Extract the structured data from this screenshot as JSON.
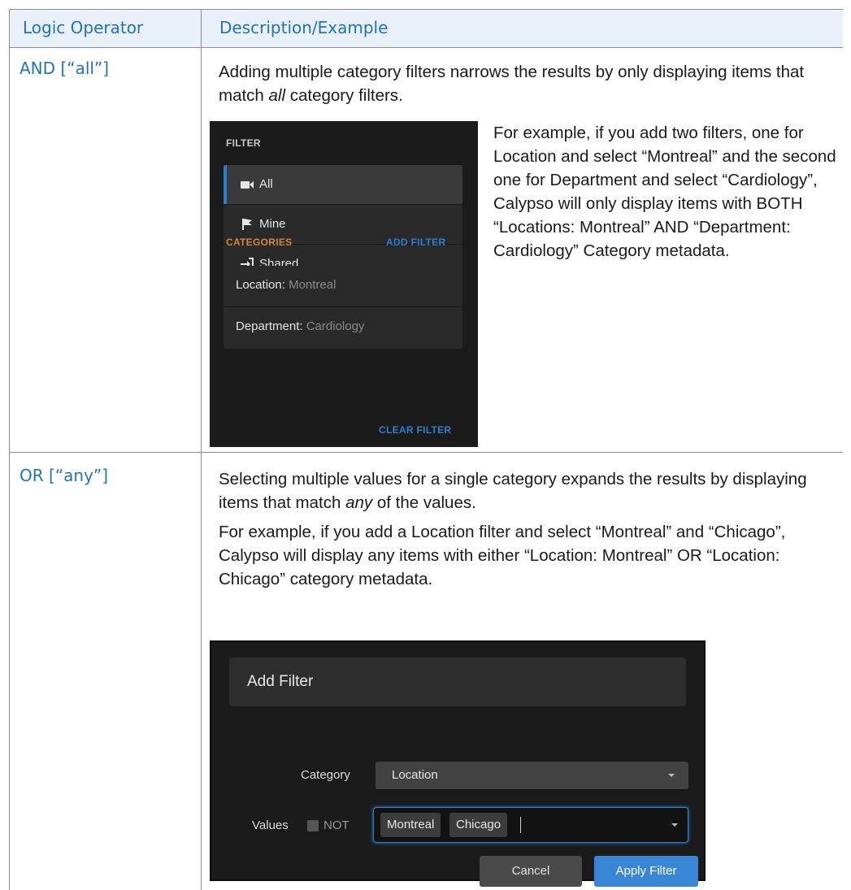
{
  "table": {
    "headers": [
      "Logic Operator",
      "Description/Example"
    ],
    "rows": [
      {
        "operator": "AND [“all”]",
        "description_pre": "Adding multiple category filters narrows the results by only displaying items that match ",
        "description_em": "all",
        "description_post": " category filters.",
        "example": "For example, if you add two filters, one for Location and select “Montreal” and the second one for Department and select “Cardiology”, Calypso will only display items with BOTH “Locations: Montreal” AND “Department: Cardiology” Category metadata."
      },
      {
        "operator": "OR [“any”]",
        "description_pre": "Selecting multiple values for a single category expands the results by displaying items that match ",
        "description_em": "any",
        "description_post": " of the values.",
        "example": "For example, if you add a Location filter and select “Montreal” and “Chicago”, Calypso will display any items with either “Location: Montreal” OR “Location: Chicago” category metadata."
      }
    ]
  },
  "filter_panel": {
    "filter_heading": "FILTER",
    "items": [
      {
        "label": "All",
        "icon": "video-camera-icon",
        "active": true
      },
      {
        "label": "Mine",
        "icon": "flag-icon",
        "active": false
      },
      {
        "label": "Shared",
        "icon": "sign-in-icon",
        "active": false
      }
    ],
    "categories_heading": "CATEGORIES",
    "add_filter_link": "ADD FILTER",
    "categories": [
      {
        "key": "Location:",
        "value": "Montreal"
      },
      {
        "key": "Department:",
        "value": "Cardiology"
      }
    ],
    "clear_filter_link": "CLEAR FILTER",
    "colors": {
      "accent": "#2f7fd0",
      "categories_heading": "#d08a3a",
      "background": "#1b1b1b"
    }
  },
  "add_filter_dialog": {
    "title": "Add Filter",
    "category_label": "Category",
    "category_value": "Location",
    "values_label": "Values",
    "not_label": "NOT",
    "not_checked": false,
    "selected_values": [
      "Montreal",
      "Chicago"
    ],
    "cancel_label": "Cancel",
    "apply_label": "Apply Filter",
    "colors": {
      "apply_button": "#3a86d6",
      "focus_border": "#2f7fd0"
    }
  }
}
